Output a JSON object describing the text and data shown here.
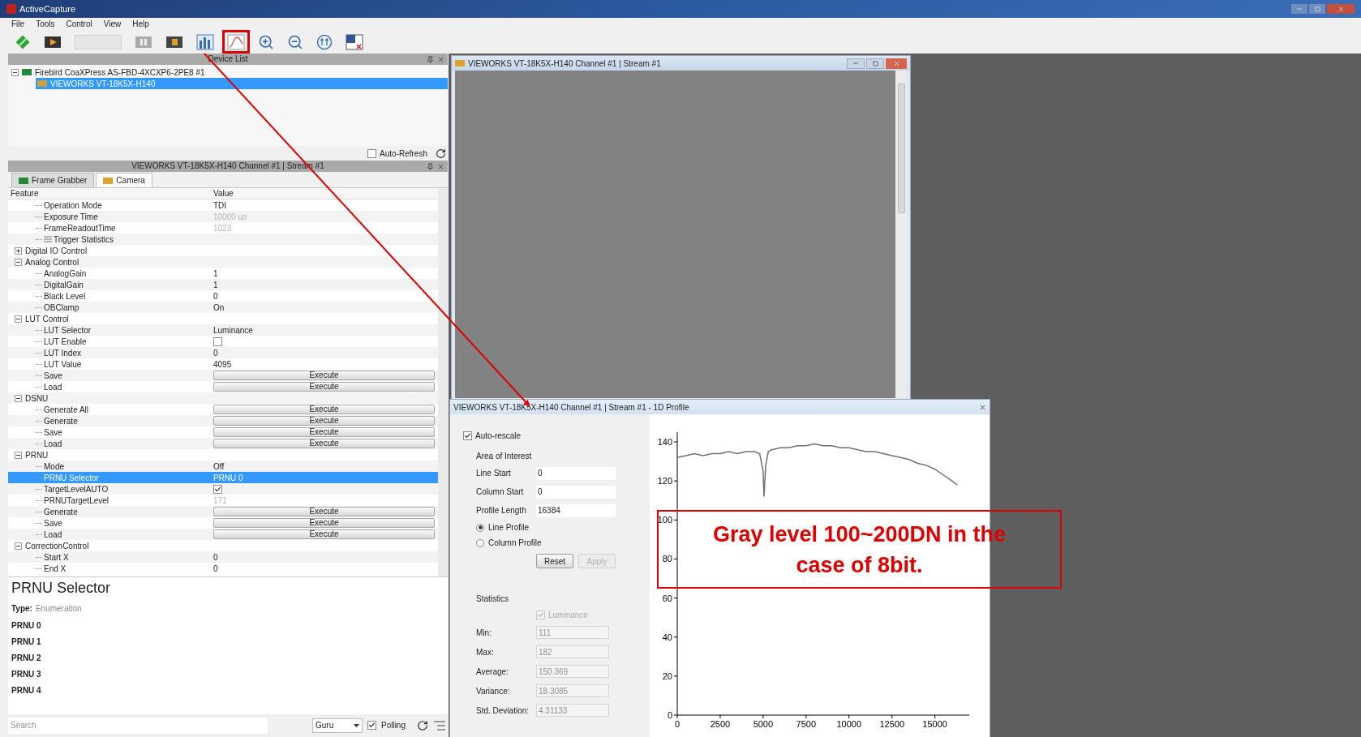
{
  "window": {
    "title": "ActiveCapture",
    "menu": [
      "File",
      "Tools",
      "Control",
      "View",
      "Help"
    ]
  },
  "toolbar": [
    {
      "kind": "diamond",
      "marked": false
    },
    {
      "kind": "record",
      "marked": false
    },
    {
      "kind": "count-field",
      "marked": false
    },
    {
      "kind": "step",
      "marked": false
    },
    {
      "kind": "stop",
      "marked": false
    },
    {
      "kind": "histogram",
      "marked": false
    },
    {
      "kind": "profile",
      "marked": true
    },
    {
      "kind": "zoom-in",
      "marked": false
    },
    {
      "kind": "zoom-out",
      "marked": false
    },
    {
      "kind": "fit",
      "marked": false
    },
    {
      "kind": "window",
      "marked": false
    }
  ],
  "device_list": {
    "title": "Device List",
    "items": [
      {
        "label": "Firebird CoaXPress AS-FBD-4XCXP6-2PE8 #1",
        "expanded": true,
        "selected": false,
        "children": [
          {
            "label": "VIEWORKS VT-18K5X-H140",
            "selected": true
          }
        ]
      }
    ],
    "auto_refresh": {
      "label": "Auto-Refresh",
      "checked": false
    }
  },
  "properties": {
    "title": "VIEWORKS VT-18K5X-H140 Channel #1 | Stream #1",
    "tabs": [
      {
        "label": "Frame Grabber",
        "selected": false
      },
      {
        "label": "Camera",
        "selected": true
      }
    ],
    "columns": [
      "Feature",
      "Value"
    ],
    "categories": [
      {
        "children": [
          {
            "name": "Operation Mode",
            "kind": "value",
            "value": "TDI",
            "selected": false
          },
          {
            "name": "Exposure Time",
            "kind": "readonly",
            "value": "10000 us",
            "selected": false
          },
          {
            "name": "FrameReadoutTime",
            "kind": "readonly",
            "value": "1023",
            "selected": false
          },
          {
            "name": "Trigger Statistics",
            "kind": "group",
            "selected": false
          }
        ]
      },
      {
        "label": "Digital IO Control",
        "expanded": false
      },
      {
        "label": "Analog Control",
        "expanded": true,
        "children": [
          {
            "name": "AnalogGain",
            "kind": "value",
            "value": "1",
            "selected": false
          },
          {
            "name": "DigitalGain",
            "kind": "value",
            "value": "1",
            "selected": false
          },
          {
            "name": "Black Level",
            "kind": "value",
            "value": "0",
            "selected": false
          },
          {
            "name": "OBClamp",
            "kind": "value",
            "value": "On",
            "selected": false
          }
        ]
      },
      {
        "label": "LUT Control",
        "expanded": true,
        "children": [
          {
            "name": "LUT Selector",
            "kind": "value",
            "value": "Luminance",
            "selected": false
          },
          {
            "name": "LUT Enable",
            "kind": "checkbox",
            "checked": false,
            "selected": false
          },
          {
            "name": "LUT Index",
            "kind": "value",
            "value": "0",
            "selected": false
          },
          {
            "name": "LUT Value",
            "kind": "value",
            "value": "4095",
            "selected": false
          },
          {
            "name": "Save",
            "kind": "execute",
            "value": "Execute",
            "selected": false
          },
          {
            "name": "Load",
            "kind": "execute",
            "value": "Execute",
            "selected": false
          }
        ]
      },
      {
        "label": "DSNU",
        "expanded": true,
        "children": [
          {
            "name": "Generate All",
            "kind": "execute",
            "value": "Execute",
            "selected": false
          },
          {
            "name": "Generate",
            "kind": "execute",
            "value": "Execute",
            "selected": false
          },
          {
            "name": "Save",
            "kind": "execute",
            "value": "Execute",
            "selected": false
          },
          {
            "name": "Load",
            "kind": "execute",
            "value": "Execute",
            "selected": false
          }
        ]
      },
      {
        "label": "PRNU",
        "expanded": true,
        "children": [
          {
            "name": "Mode",
            "kind": "value",
            "value": "Off",
            "selected": false
          },
          {
            "name": "PRNU Selector",
            "kind": "value",
            "value": "PRNU 0",
            "selected": true
          },
          {
            "name": "TargetLevelAUTO",
            "kind": "checkbox",
            "checked": true,
            "selected": false
          },
          {
            "name": "PRNUTargetLevel",
            "kind": "readonly",
            "value": "171",
            "selected": false
          },
          {
            "name": "Generate",
            "kind": "execute",
            "value": "Execute",
            "selected": false
          },
          {
            "name": "Save",
            "kind": "execute",
            "value": "Execute",
            "selected": false
          },
          {
            "name": "Load",
            "kind": "execute",
            "value": "Execute",
            "selected": false
          }
        ]
      },
      {
        "label": "CorrectionControl",
        "expanded": true,
        "children": [
          {
            "name": "Start X",
            "kind": "value",
            "value": "0",
            "selected": false
          },
          {
            "name": "End X",
            "kind": "value",
            "value": "0",
            "selected": false
          }
        ]
      }
    ]
  },
  "description": {
    "title": "PRNU Selector",
    "type_label": "Type:",
    "type_value": "Enumeration",
    "entries": [
      "PRNU 0",
      "PRNU 1",
      "PRNU 2",
      "PRNU 3",
      "PRNU 4"
    ]
  },
  "bottom_bar": {
    "search_placeholder": "Search",
    "visibility": "Guru",
    "polling": {
      "label": "Polling",
      "checked": true
    }
  },
  "image_window": {
    "title": "VIEWORKS VT-18K5X-H140 Channel #1 | Stream #1"
  },
  "profile_window": {
    "title": "VIEWORKS VT-18K5X-H140 Channel #1 | Stream #1 - 1D Profile",
    "auto_rescale": {
      "label": "Auto-rescale",
      "checked": true
    },
    "area_of_interest": {
      "title": "Area of Interest",
      "fields": [
        {
          "label": "Line Start",
          "value": "0"
        },
        {
          "label": "Column Start",
          "value": "0"
        },
        {
          "label": "Profile Length",
          "value": "16384"
        }
      ]
    },
    "profiles": [
      {
        "label": "Line Profile",
        "selected": true
      },
      {
        "label": "Column Profile",
        "selected": false
      }
    ],
    "buttons": [
      {
        "label": "Reset",
        "disabled": false
      },
      {
        "label": "Apply",
        "disabled": true
      }
    ],
    "statistics": {
      "title": "Statistics",
      "luminance": {
        "label": "Luminance",
        "checked": true
      },
      "fields": [
        {
          "label": "Min:",
          "value": "111"
        },
        {
          "label": "Max:",
          "value": "182"
        },
        {
          "label": "Average:",
          "value": "150.369"
        },
        {
          "label": "Variance:",
          "value": "18.3085"
        },
        {
          "label": "Std. Deviation:",
          "value": "4.31133"
        }
      ]
    },
    "chart_data": {
      "type": "line",
      "x": [
        0,
        500,
        1000,
        1500,
        2000,
        2500,
        3000,
        3500,
        4000,
        4500,
        4800,
        5000,
        5050,
        5150,
        5300,
        5500,
        6000,
        6500,
        7000,
        7500,
        8000,
        8500,
        9000,
        9500,
        10000,
        10500,
        11000,
        11500,
        12000,
        12500,
        13000,
        13500,
        14000,
        14500,
        15000,
        15500,
        16000,
        16300
      ],
      "series": [
        {
          "color": "#707070",
          "values": [
            132,
            133,
            134,
            133,
            134,
            134,
            135,
            134,
            135,
            135,
            134,
            125,
            112,
            128,
            135,
            136,
            137,
            137,
            138,
            138,
            139,
            138,
            138,
            137,
            137,
            136,
            135,
            135,
            134,
            133,
            132,
            131,
            129,
            128,
            126,
            123,
            120,
            118
          ]
        }
      ],
      "xlim": [
        0,
        17000
      ],
      "ylim": [
        0,
        145
      ],
      "xticks": [
        0,
        2500,
        5000,
        7500,
        10000,
        12500,
        15000
      ],
      "yticks": [
        0,
        20,
        40,
        60,
        80,
        100,
        120,
        140
      ]
    }
  },
  "annotation": {
    "text": "Gray level 100~200DN in the case of 8bit."
  }
}
